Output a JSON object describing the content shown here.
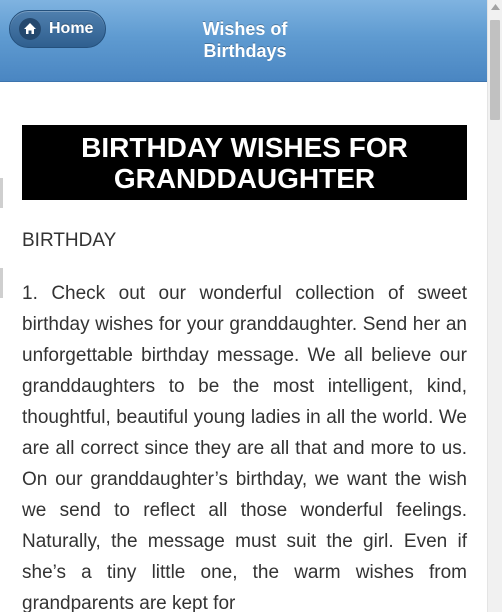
{
  "header": {
    "home_label": "Home",
    "title": "Wishes of Birthdays"
  },
  "article": {
    "heading": "BIRTHDAY WISHES FOR GRANDDAUGHTER",
    "section_label": "BIRTHDAY",
    "paragraph": "1. Check out our wonderful collection of sweet birthday wishes for your granddaughter. Send her an unforgettable birthday message. We all believe our granddaughters to be the most intelligent, kind, thoughtful, beautiful young ladies in all the world. We are all correct since they are all that and more to us. On our granddaughter’s birthday, we want the wish we send to reflect all those wonderful feelings. Naturally, the message must suit the girl. Even if she’s a tiny little one, the warm wishes from grandparents are kept for"
  }
}
